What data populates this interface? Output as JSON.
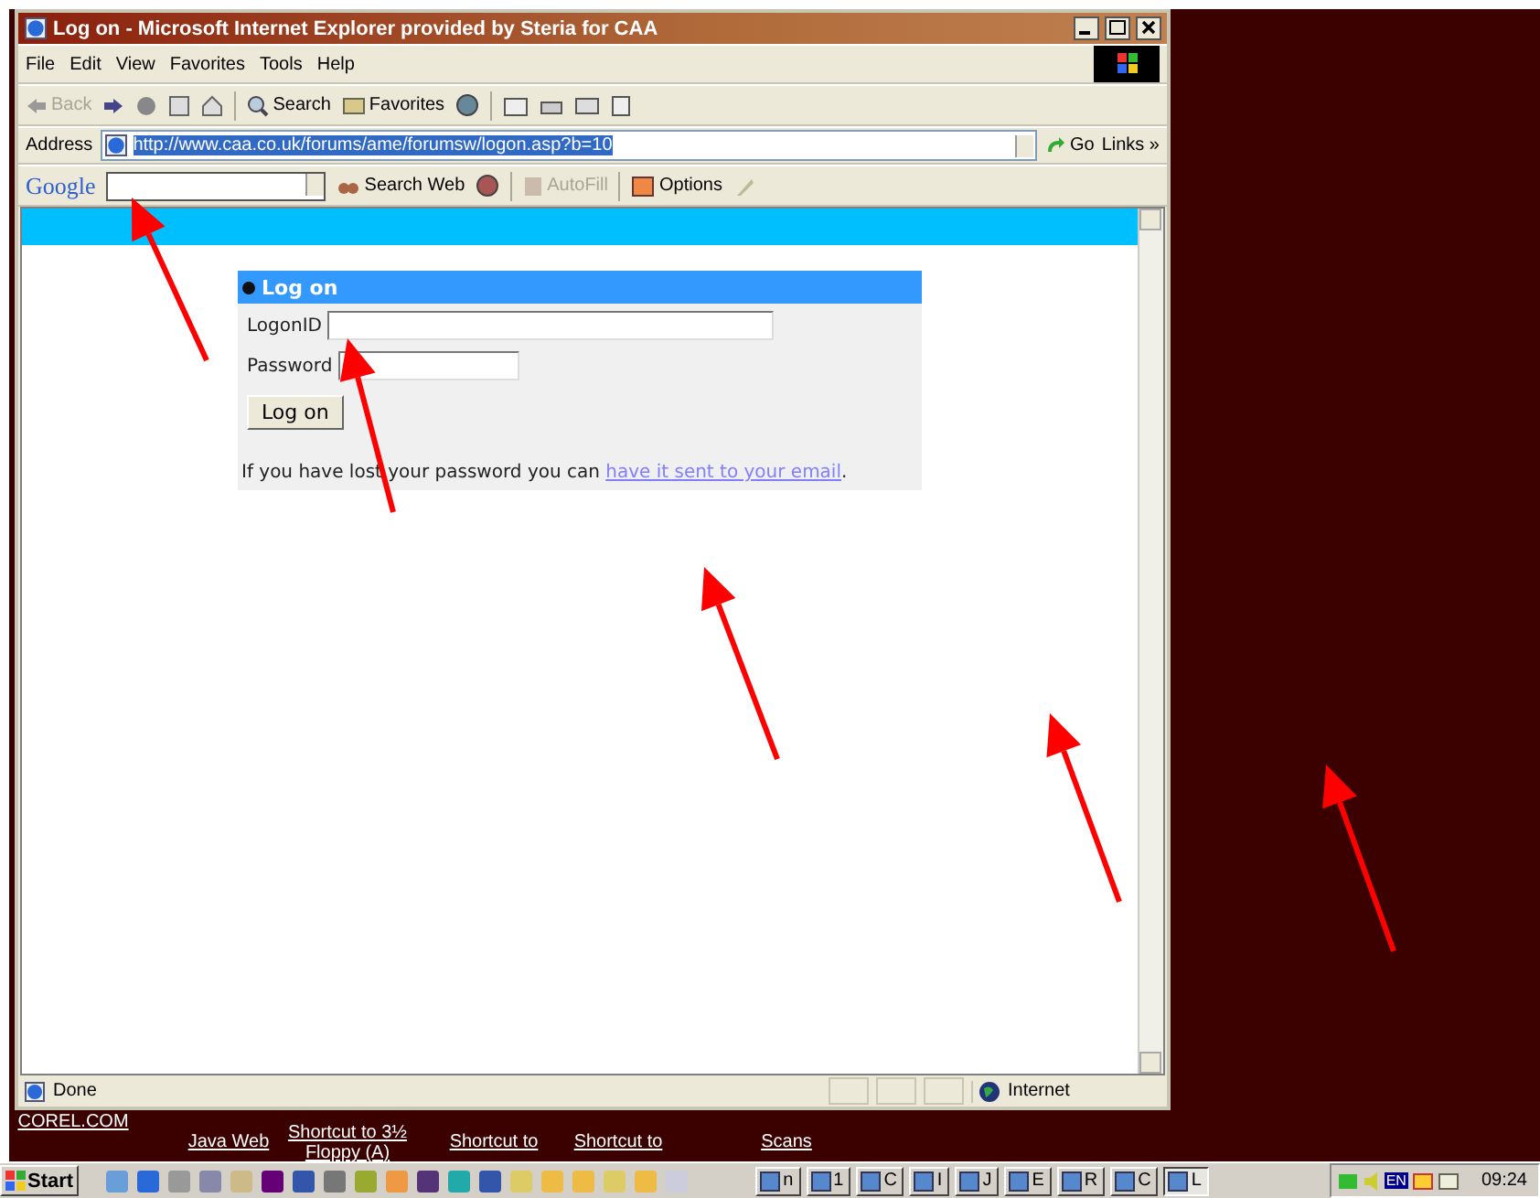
{
  "window": {
    "title": "Log on - Microsoft Internet Explorer provided by Steria for CAA",
    "menu": [
      "File",
      "Edit",
      "View",
      "Favorites",
      "Tools",
      "Help"
    ],
    "toolbar": [
      {
        "label": "Back",
        "disabled": true
      },
      {
        "label": "Search",
        "disabled": false
      },
      {
        "label": "Favorites",
        "disabled": false
      }
    ],
    "address": {
      "label": "Address",
      "value": "http://www.caa.co.uk/forums/ame/forumsw/logon.asp?b=10",
      "go": "Go",
      "links": "Links",
      "links_more": "»"
    },
    "google_toolbar": {
      "logo": "Google",
      "items": [
        {
          "label": "Search Web",
          "disabled": false
        },
        {
          "label": "AutoFill",
          "disabled": true
        },
        {
          "label": "Options",
          "disabled": false
        }
      ]
    },
    "page": {
      "panel_title": "Log on",
      "fields": [
        {
          "label": "LogonID",
          "kind": "text"
        },
        {
          "label": "Password",
          "kind": "password"
        }
      ],
      "button": "Log on",
      "note": "If you have lost your password you can ",
      "link": "have it sent to your email",
      "note_end": "."
    },
    "status_bar": {
      "text": "Done",
      "zone": "Internet"
    }
  },
  "desktop_icons": [
    {
      "label": "COREL.COM"
    },
    {
      "label": "Java Web"
    },
    {
      "label": "Shortcut to 3½ Floppy (A)"
    },
    {
      "label": "Shortcut to"
    },
    {
      "label": "Shortcut to"
    },
    {
      "label": "Scans"
    }
  ],
  "taskbar": {
    "start": "Start",
    "tasks": [
      {
        "label": "n",
        "selected": false
      },
      {
        "label": "1",
        "selected": false
      },
      {
        "label": "C",
        "selected": false
      },
      {
        "label": "I",
        "selected": false
      },
      {
        "label": "J",
        "selected": false
      },
      {
        "label": "E",
        "selected": false
      },
      {
        "label": "R",
        "selected": false
      },
      {
        "label": "C",
        "selected": false
      },
      {
        "label": "L",
        "selected": true
      }
    ],
    "language": "EN",
    "clock": "09:24"
  }
}
